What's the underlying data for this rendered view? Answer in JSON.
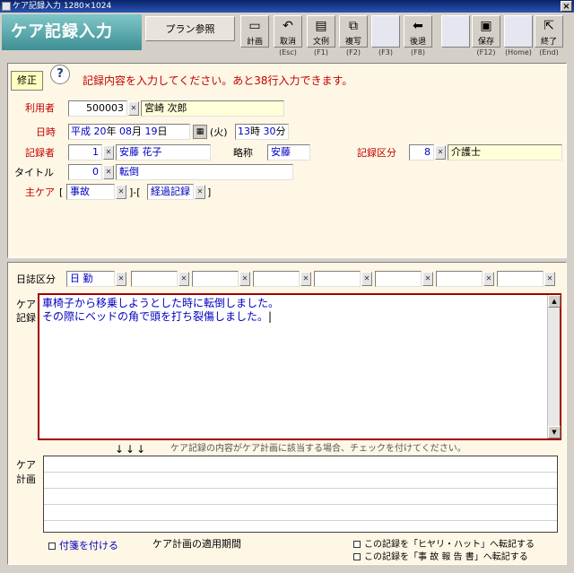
{
  "window": {
    "title": "ケア記録入力 1280×1024",
    "close": "×"
  },
  "app_title": "ケア記録入力",
  "plan_button": "プラン参照",
  "toolbar": [
    {
      "label": "計画",
      "key": "",
      "icon": "monitor-icon",
      "glyph": "▭"
    },
    {
      "label": "取消",
      "key": "(Esc)",
      "icon": "undo-icon",
      "glyph": "↶"
    },
    {
      "label": "文例",
      "key": "(F1)",
      "icon": "document-icon",
      "glyph": "▤"
    },
    {
      "label": "複写",
      "key": "(F2)",
      "icon": "copy-icon",
      "glyph": "⧉"
    },
    {
      "label": "",
      "key": "(F3)",
      "icon": "blank",
      "glyph": ""
    },
    {
      "label": "後退",
      "key": "(F8)",
      "icon": "back-arrow-icon",
      "glyph": "⬅"
    },
    {
      "label": "",
      "key": "",
      "icon": "blank",
      "glyph": ""
    },
    {
      "label": "保存",
      "key": "(F12)",
      "icon": "save-disk-icon",
      "glyph": "▣"
    },
    {
      "label": "",
      "key": "(Home)",
      "icon": "blank",
      "glyph": ""
    },
    {
      "label": "終了",
      "key": "(End)",
      "icon": "exit-door-icon",
      "glyph": "⇱"
    }
  ],
  "mode_badge": "修正",
  "help_icon": "?",
  "message": "記録内容を入力してください。あと38行入力できます。",
  "form": {
    "user_label": "利用者",
    "user_id": "500003",
    "user_name": "宮崎 次郎",
    "datetime_label": "日時",
    "era": "平成",
    "year": "20",
    "year_unit": "年",
    "month": "08",
    "month_unit": "月",
    "day": "19",
    "day_unit": "日",
    "weekday": "(火)",
    "hour": "13",
    "hour_unit": "時",
    "minute": "30",
    "minute_unit": "分",
    "recorder_label": "記録者",
    "recorder_id": "1",
    "recorder_name": "安藤 花子",
    "abbr_label": "略称",
    "abbr_value": "安藤",
    "category_label": "記録区分",
    "category_id": "8",
    "category_name": "介護士",
    "title_label": "タイトル",
    "title_id": "0",
    "title_value": "転倒",
    "main_care_label": "主ケア",
    "main_care_1": "事故",
    "main_care_2": "経過記録",
    "bracket_open": "[",
    "bracket_close": "]",
    "bracket_join": "]-["
  },
  "diary": {
    "label": "日誌区分",
    "first_value": "日 勤",
    "extra_fields": 7
  },
  "care_record": {
    "label_1": "ケア",
    "label_2": "記録",
    "lines": [
      "車椅子から移乗しようとした時に転倒しました。",
      "その際にベッドの角で頭を打ち裂傷しました。"
    ]
  },
  "arrows": "↓↓↓",
  "hint": "ケア記録の内容がケア計画に該当する場合、チェックを付けてください。",
  "care_plan": {
    "label_1": "ケア",
    "label_2": "計画"
  },
  "bottom": {
    "tag_checkbox": "付箋を付ける",
    "period_label": "ケア計画の適用期間",
    "transfer_hiyari": "この記録を「ヒヤリ・ハット」へ転記する",
    "transfer_accident": "この記録を「事 故 報 告 書」へ転記する"
  }
}
